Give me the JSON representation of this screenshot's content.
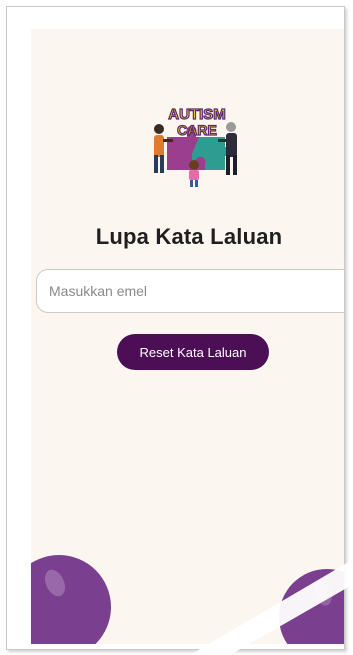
{
  "logo": {
    "text_line1": "AUTISM",
    "text_line2": "CARE"
  },
  "page": {
    "title": "Lupa Kata Laluan"
  },
  "form": {
    "email_placeholder": "Masukkan emel",
    "email_value": "",
    "reset_label": "Reset Kata Laluan"
  },
  "colors": {
    "background": "#fcf6f1",
    "primary": "#4c0f55",
    "blob": "#7b3f8f"
  }
}
